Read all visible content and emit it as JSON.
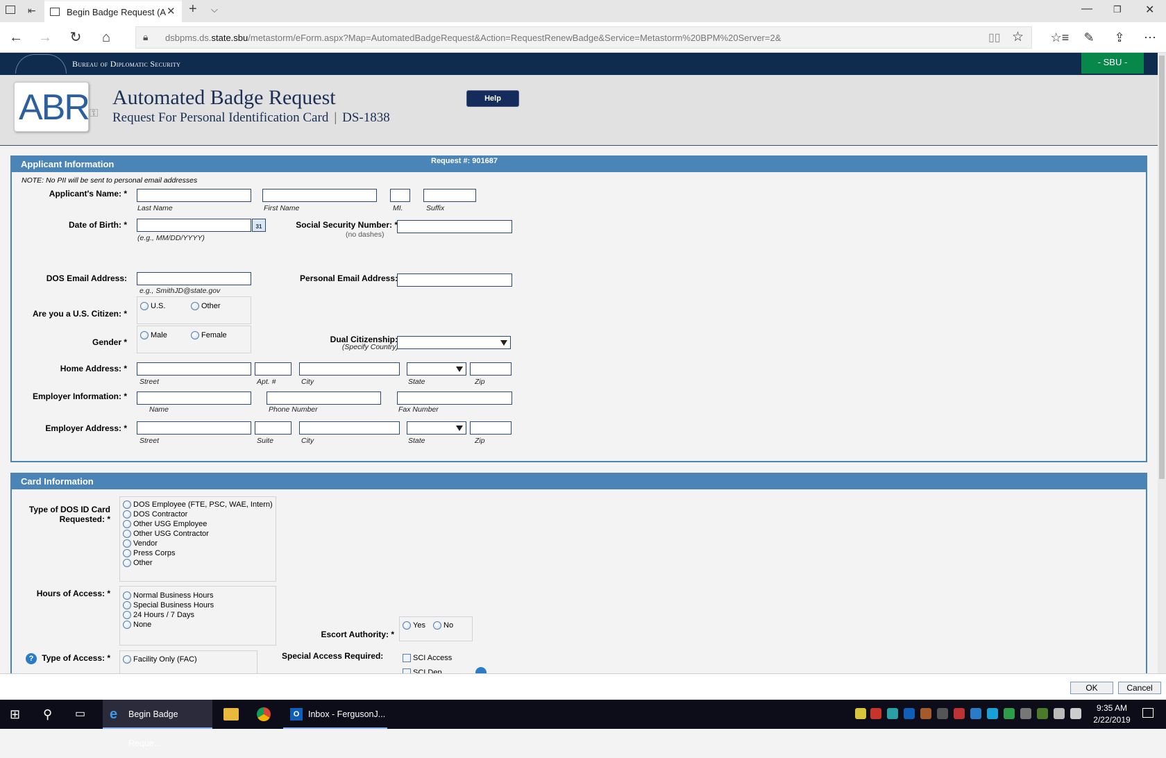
{
  "browser": {
    "tab_title": "Begin Badge Request (A",
    "url_prefix": "dsbpms.ds.",
    "url_domain": "state.sbu",
    "url_rest": "/metastorm/eForm.aspx?Map=AutomatedBadgeRequest&Action=RequestRenewBadge&Service=Metastorm%20BPM%20Server=2&"
  },
  "site": {
    "bureau": "Bureau of Diplomatic Security",
    "classification": "- SBU -",
    "logo_text": "ABR",
    "title": "Automated Badge Request",
    "subtitle": "Request For Personal Identification Card",
    "form_number": "DS-1838",
    "help_label": "Help"
  },
  "applicant": {
    "header": "Applicant Information",
    "request_number": "Request #: 901687",
    "note": "NOTE: No PII will be sent to personal email addresses",
    "name_label": "Applicant's Name: *",
    "name_hints": {
      "last": "Last Name",
      "first": "First Name",
      "mi": "MI.",
      "suffix": "Suffix"
    },
    "dob_label": "Date of Birth: *",
    "dob_hint": "(e.g., MM/DD/YYYY)",
    "calendar_text": "31",
    "ssn_label": "Social Security Number: *",
    "ssn_hint": "(no dashes)",
    "dos_email_label": "DOS Email Address:",
    "dos_email_hint": "e.g., SmithJD@state.gov",
    "personal_email_label": "Personal Email Address:",
    "citizen_label": "Are you a U.S. Citizen: *",
    "citizen_options": [
      "U.S.",
      "Other"
    ],
    "gender_label": "Gender *",
    "gender_options": [
      "Male",
      "Female"
    ],
    "dual_label": "Dual Citizenship:",
    "dual_hint": "(Specify Country)",
    "home_label": "Home Address: *",
    "home_hints": {
      "street": "Street",
      "apt": "Apt. #",
      "city": "City",
      "state": "State",
      "zip": "Zip"
    },
    "employer_label": "Employer Information: *",
    "employer_hints": {
      "name": "Name",
      "phone": "Phone Number",
      "fax": "Fax Number"
    },
    "emp_addr_label": "Employer Address: *",
    "emp_addr_hints": {
      "street": "Street",
      "suite": "Suite",
      "city": "City",
      "state": "State",
      "zip": "Zip"
    }
  },
  "card": {
    "header": "Card Information",
    "type_label_1": "Type of DOS ID Card",
    "type_label_2": "Requested: *",
    "type_options": [
      "DOS Employee (FTE, PSC, WAE, Intern)",
      "DOS Contractor",
      "Other USG Employee",
      "Other USG Contractor",
      "Vendor",
      "Press Corps",
      "Other"
    ],
    "hours_label": "Hours of Access: *",
    "hours_options": [
      "Normal Business Hours",
      "Special Business Hours",
      "24 Hours / 7 Days",
      "None"
    ],
    "escort_label": "Escort Authority: *",
    "escort_options": [
      "Yes",
      "No"
    ],
    "access_type_label": "Type of Access: *",
    "access_type_options": [
      "Facility Only (FAC)"
    ],
    "special_label": "Special Access Required:",
    "special_options": [
      "SCI Access",
      "SCI Dep..."
    ]
  },
  "dialog": {
    "ok": "OK",
    "cancel": "Cancel"
  },
  "taskbar": {
    "edge_label": "Begin Badge Reque...",
    "outlook_label": "Inbox - FergusonJ...",
    "time": "9:35 AM",
    "date": "2/22/2019"
  },
  "colors": {
    "band": "#0f2b4e",
    "sbu": "#08874b",
    "panel_header": "#4b84b7",
    "help_button": "#132c5c"
  }
}
